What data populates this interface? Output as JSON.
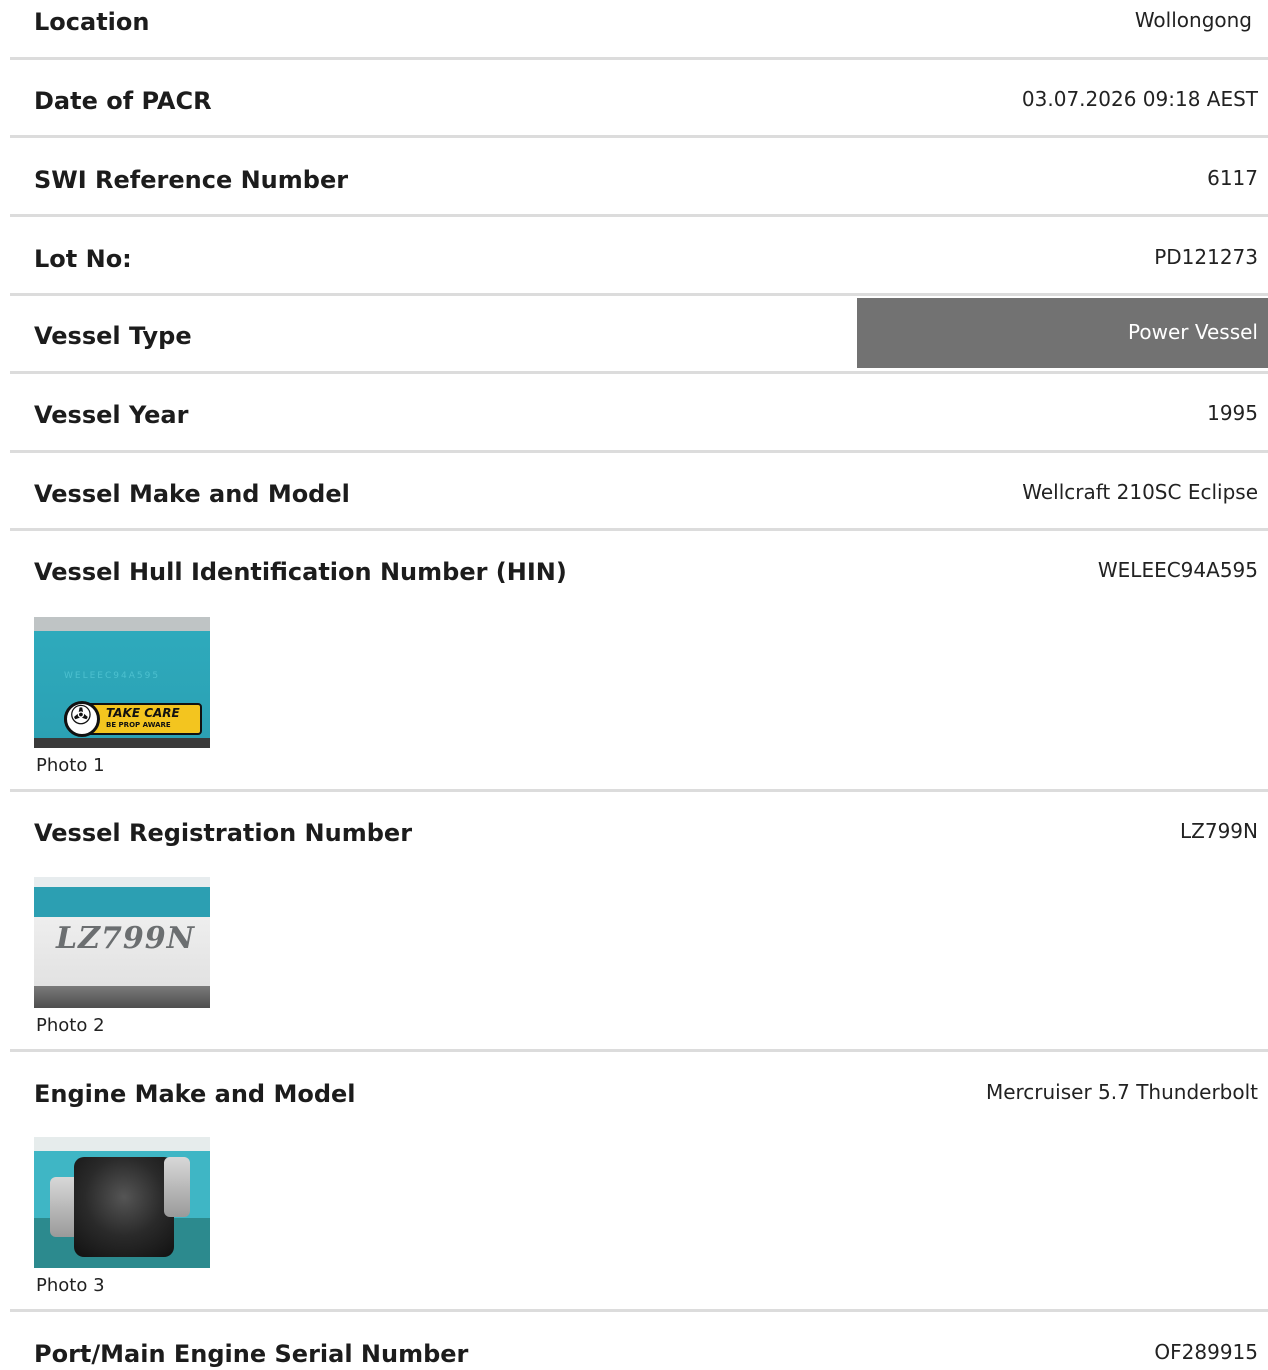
{
  "rows": [
    {
      "label": "Location",
      "value": "Wollongong"
    },
    {
      "label": "Date of PACR",
      "value": "03.07.2026 09:18 AEST"
    },
    {
      "label": "SWI Reference Number",
      "value": "6117"
    },
    {
      "label": "Lot No:",
      "value": "PD121273"
    },
    {
      "label": "Vessel Type",
      "value": "Power Vessel"
    },
    {
      "label": "Vessel Year",
      "value": "1995"
    },
    {
      "label": "Vessel Make and Model",
      "value": "Wellcraft 210SC Eclipse"
    },
    {
      "label": "Vessel Hull Identification Number (HIN)",
      "value": "WELEEC94A595"
    },
    {
      "label": "Vessel Registration Number",
      "value": "LZ799N"
    },
    {
      "label": "Engine Make and Model",
      "value": "Mercruiser 5.7 Thunderbolt"
    },
    {
      "label": "Port/Main Engine Serial Number",
      "value": "OF289915"
    }
  ],
  "photos": [
    {
      "caption": "Photo 1",
      "sticker_line1": "TAKE CARE",
      "sticker_line2": "BE PROP AWARE",
      "hull_text": "WELEEC94A595"
    },
    {
      "caption": "Photo 2",
      "hull_text": "LZ799N"
    },
    {
      "caption": "Photo 3"
    }
  ],
  "colors": {
    "highlight_box": "#727272",
    "divider": "#dcdcdc"
  }
}
